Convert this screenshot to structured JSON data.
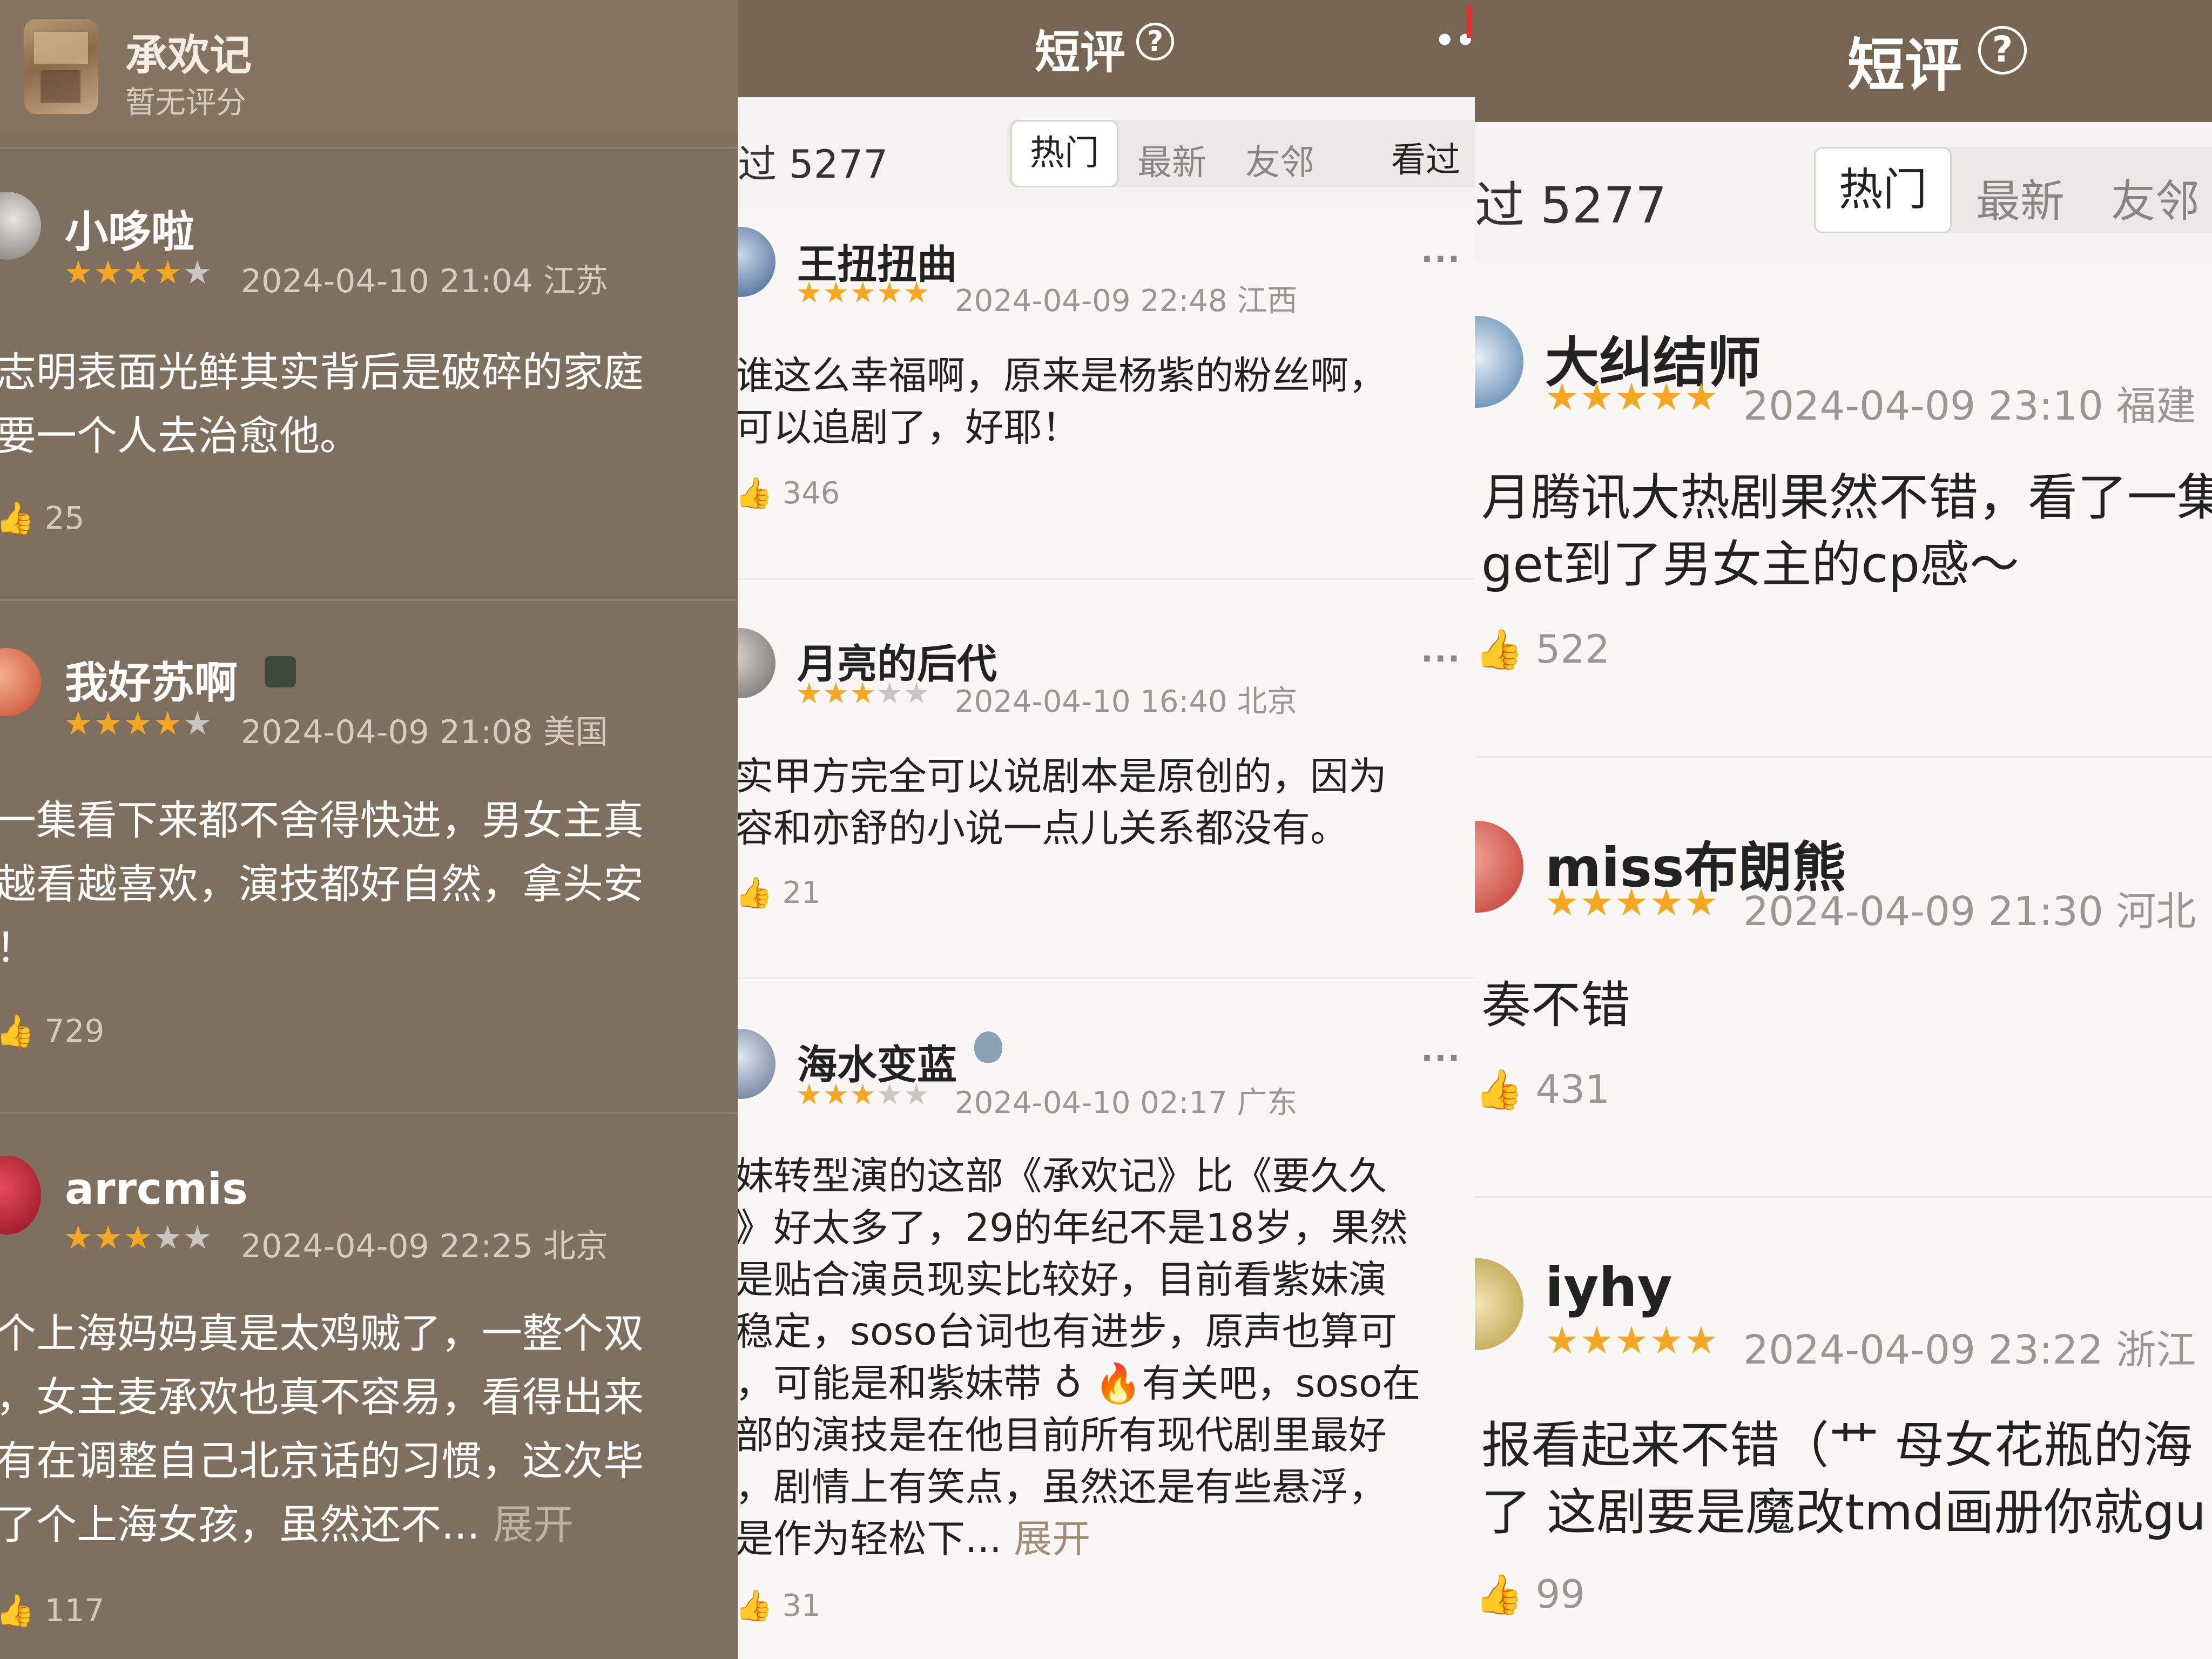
{
  "panel1": {
    "show": {
      "title": "承欢记",
      "rating": "暂无评分"
    },
    "reviews": [
      {
        "user": "小哆啦",
        "stars": 4,
        "date": "2024-04-10 21:04 江苏",
        "text": "志明表面光鲜其实背后是破碎的家庭\n要一个人去治愈他。",
        "votes": "25"
      },
      {
        "user": "我好苏啊",
        "stars": 4,
        "date": "2024-04-09 21:08 美国",
        "text": "一集看下来都不舍得快进，男女主真\n越看越喜欢，演技都好自然，拿头安\n！",
        "votes": "729"
      },
      {
        "user": "arrcmis",
        "stars": 3,
        "date": "2024-04-09 22:25 北京",
        "text": "个上海妈妈真是太鸡贼了，一整个双\n，女主麦承欢也真不容易，看得出来\n有在调整自己北京话的习惯，这次毕\n了个上海女孩，虽然还不... ",
        "expand": "展开",
        "votes": "117"
      }
    ]
  },
  "panel2": {
    "header": {
      "title": "短评",
      "help": "?",
      "more": "••"
    },
    "seen_count": "过 5277",
    "tabs": [
      "热门",
      "最新",
      "友邻"
    ],
    "seen_button": "看过",
    "reviews": [
      {
        "user": "王扭扭曲",
        "stars": 5,
        "date": "2024-04-09 22:48 江西",
        "text": "谁这么幸福啊，原来是杨紫的粉丝啊，\n可以追剧了，好耶！",
        "votes": "346"
      },
      {
        "user": "月亮的后代",
        "stars": 3,
        "date": "2024-04-10 16:40 北京",
        "text": "实甲方完全可以说剧本是原创的，因为\n容和亦舒的小说一点儿关系都没有。",
        "votes": "21"
      },
      {
        "user": "海水变蓝",
        "stars": 3,
        "date": "2024-04-10 02:17 广东",
        "text": "妹转型演的这部《承欢记》比《要久久\n》好太多了，29的年纪不是18岁，果然\n是贴合演员现实比较好，目前看紫妹演\n稳定，soso台词也有进步，原声也算可\n，可能是和紫妹带 ♁ 🔥有关吧，soso在\n部的演技是在他目前所有现代剧里最好\n，剧情上有笑点，虽然还是有些悬浮，\n是作为轻松下... ",
        "expand": "展开",
        "votes": "31"
      }
    ]
  },
  "panel3": {
    "header": {
      "title": "短评",
      "help": "?"
    },
    "seen_count": "过 5277",
    "tabs": [
      "热门",
      "最新",
      "友邻"
    ],
    "reviews": [
      {
        "user": "大纠结师",
        "stars": 5,
        "date": "2024-04-09 23:10 福建",
        "text": "月腾讯大热剧果然不错，看了一集\nget到了男女主的cp感～",
        "votes": "522"
      },
      {
        "user": "miss布朗熊",
        "stars": 5,
        "date": "2024-04-09 21:30 河北",
        "text": "奏不错",
        "votes": "431"
      },
      {
        "user": "iyhy",
        "stars": 5,
        "date": "2024-04-09 23:22 浙江",
        "text": "报看起来不错（艹 母女花瓶的海\n了 这剧要是魔改tmd画册你就gu",
        "votes": "99"
      }
    ]
  },
  "colors": {
    "star": "#f5a623",
    "star_empty": "#c9c5c0",
    "header_brown": "#756552",
    "panel1_bg": "#7e6f5e"
  }
}
